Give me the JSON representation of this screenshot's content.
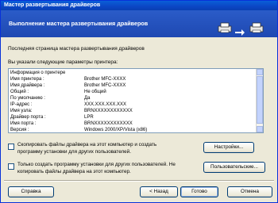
{
  "window": {
    "title": "Мастер развертывания драйверов"
  },
  "header": {
    "title": "Выполнение мастера развертывания драйверов"
  },
  "content": {
    "subtitle": "Последняя страница мастера развертывания драйверов",
    "params_label": "Вы указали следующие параметры принтера:",
    "rows": [
      {
        "key": "Информация о принтере",
        "value": ""
      },
      {
        "key": "Имя принтера :",
        "value": "Brother MFC-XXXX"
      },
      {
        "key": "Имя драйвера :",
        "value": "Brother MFC-XXXX"
      },
      {
        "key": "Общий :",
        "value": "Не общий"
      },
      {
        "key": "По умолчанию :",
        "value": "Да"
      },
      {
        "key": "IP-адрес :",
        "value": "XXX.XXX.XXX.XXX"
      },
      {
        "key": "Имя узла:",
        "value": "BRNXXXXXXXXXXXX"
      },
      {
        "key": "Драйвер порта :",
        "value": "LPR"
      },
      {
        "key": "Имя порта :",
        "value": "BRNXXXXXXXXXXXX"
      },
      {
        "key": "Версия :",
        "value": "Windows 2000/XP/Vista (x86)"
      }
    ]
  },
  "options": {
    "copy_files_text": "Скопировать файлы драйвера на этот компьютер и создать программу установки для других пользователей.",
    "create_only_text": "Только создать программу установки для других пользователей. Не копировать файлы драйвера на этот компьютер."
  },
  "buttons": {
    "settings": "Настройки...",
    "custom": "Пользовательские...",
    "help": "Справка",
    "back": "< Назад",
    "finish": "Готово",
    "cancel": "Отмена"
  }
}
